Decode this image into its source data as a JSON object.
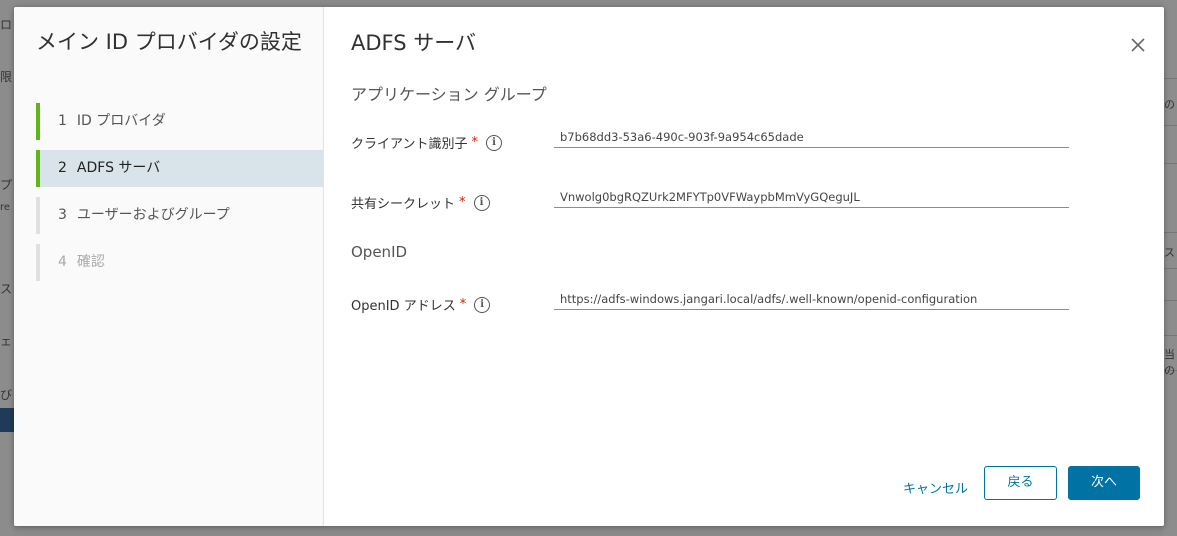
{
  "background": {
    "left_fragments": [
      "ロ",
      "限",
      "プ",
      "re",
      "ス",
      "ェ",
      "び"
    ],
    "right_fragments": [
      "の",
      "ス",
      "当の"
    ]
  },
  "wizard": {
    "title": "メイン ID プロバイダの設定",
    "steps": [
      {
        "num": "1",
        "label": "ID プロバイダ",
        "state": "done"
      },
      {
        "num": "2",
        "label": "ADFS サーバ",
        "state": "active"
      },
      {
        "num": "3",
        "label": "ユーザーおよびグループ",
        "state": "pending"
      },
      {
        "num": "4",
        "label": "確認",
        "state": "disabled"
      }
    ]
  },
  "page": {
    "title": "ADFS サーバ",
    "close_icon": "close-icon",
    "app_group_heading": "アプリケーション グループ",
    "client_id_label": "クライアント識別子",
    "client_id_value": "b7b68dd3-53a6-490c-903f-9a954c65dade",
    "shared_secret_label": "共有シークレット",
    "shared_secret_value": "Vnwolg0bgRQZUrk2MFYTp0VFWaypbMmVyGQeguJL",
    "openid_heading": "OpenID",
    "openid_address_label": "OpenID アドレス",
    "openid_address_value": "https://adfs-windows.jangari.local/adfs/.well-known/openid-configuration",
    "required_mark": "*",
    "info_glyph": "i"
  },
  "footer": {
    "cancel_label": "キャンセル",
    "back_label": "戻る",
    "next_label": "次へ"
  },
  "colors": {
    "accent": "#0072a3",
    "step_complete": "#5eb715",
    "required": "#c92100"
  }
}
